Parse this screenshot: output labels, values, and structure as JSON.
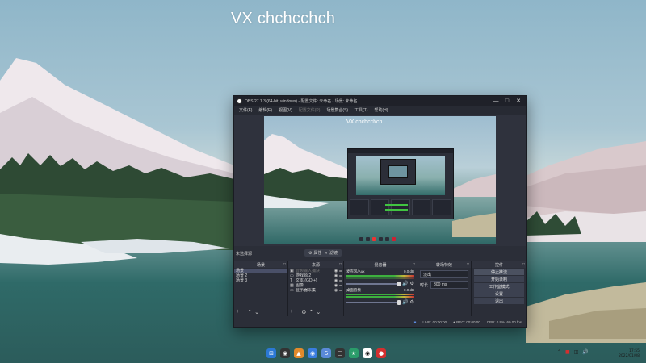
{
  "desktop": {
    "overlay_text": "VX chchcchch"
  },
  "obs": {
    "title": "OBS 27.1.3 (64-bit, windows) - 配置文件: 未命名 - 场景: 未命名",
    "menu": [
      "文件(F)",
      "编辑(E)",
      "视图(V)",
      "配置文件(P)",
      "场景集合(S)",
      "工具(T)",
      "帮助(H)"
    ],
    "preview_title": "VX chchcchch",
    "current_scene_label": "未选择源",
    "properties_label": "属性",
    "filters_label": "滤镜",
    "docks": {
      "scenes": {
        "title": "场景",
        "items": [
          "场景",
          "场景 2",
          "场景 3"
        ]
      },
      "sources": {
        "title": "来源",
        "items": [
          {
            "icon": "window-icon",
            "label": "音频输入捕获",
            "disabled": true
          },
          {
            "icon": "display-icon",
            "label": "游戏源 2",
            "disabled": false
          },
          {
            "icon": "text-icon",
            "label": "文本 (GDI+)",
            "disabled": false
          },
          {
            "icon": "image-icon",
            "label": "图像",
            "disabled": false
          },
          {
            "icon": "display-icon",
            "label": "显示器采集",
            "disabled": false
          }
        ]
      },
      "mixer": {
        "title": "混音器",
        "channels": [
          {
            "name": "麦克风/Aux",
            "db": "0.0 dB"
          },
          {
            "name": "桌面音频",
            "db": "0.0 dB"
          }
        ]
      },
      "transitions": {
        "title": "转场特效",
        "selected": "淡出",
        "duration_label": "时长",
        "duration_value": "300 ms"
      },
      "controls": {
        "title": "控件",
        "buttons": [
          "停止推流",
          "开始录制",
          "工作室模式",
          "设置",
          "退出"
        ]
      }
    },
    "status": {
      "live_label": "LIVE:",
      "live_time": "00:00:00",
      "rec_label": "REC:",
      "rec_time": "00:00:00",
      "cpu": "CPU: 0.9%, 60.00 fps"
    }
  },
  "taskbar": {
    "time": "17:55",
    "date": "2022/01/08"
  }
}
